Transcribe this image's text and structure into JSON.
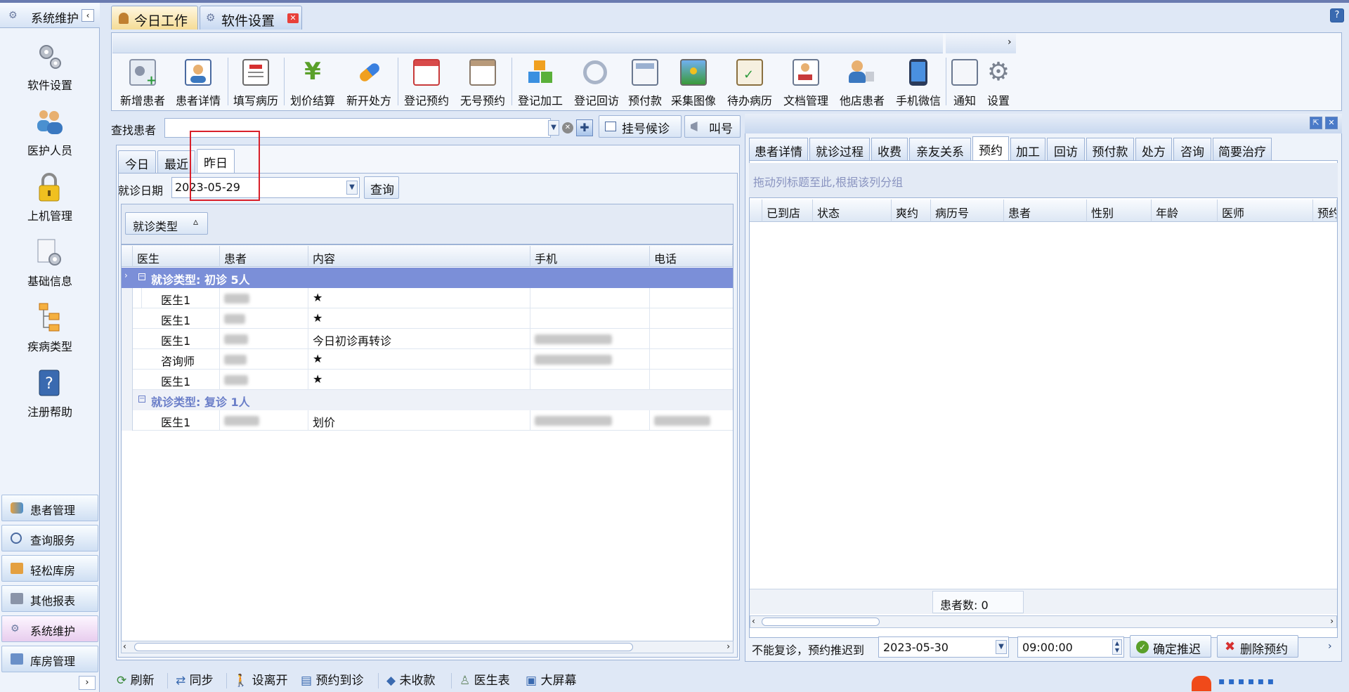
{
  "nav": {
    "header": "系统维护",
    "items": [
      {
        "label": "软件设置",
        "icon": "gears-icon"
      },
      {
        "label": "医护人员",
        "icon": "staff-icon"
      },
      {
        "label": "上机管理",
        "icon": "lock-icon"
      },
      {
        "label": "基础信息",
        "icon": "info-gear-icon"
      },
      {
        "label": "疾病类型",
        "icon": "tree-icon"
      },
      {
        "label": "注册帮助",
        "icon": "help-book-icon"
      }
    ],
    "sections": [
      "患者管理",
      "查询服务",
      "轻松库房",
      "其他报表",
      "系统维护",
      "库房管理"
    ]
  },
  "tabs": [
    {
      "label": "今日工作"
    },
    {
      "label": "软件设置"
    }
  ],
  "toolbar": {
    "buttons": [
      "新增患者",
      "患者详情",
      "填写病历",
      "划价结算",
      "新开处方",
      "登记预约",
      "无号预约",
      "登记加工",
      "登记回访",
      "预付款",
      "采集图像",
      "待办病历",
      "文档管理",
      "他店患者",
      "手机微信"
    ],
    "extra": [
      "通知",
      "设置"
    ],
    "more": "›"
  },
  "search": {
    "label": "查找患者",
    "value": "",
    "queue_button": "挂号候诊",
    "call_button": "叫号"
  },
  "left": {
    "tabs": [
      "今日",
      "最近",
      "昨日"
    ],
    "date_label": "就诊日期",
    "date_value": "2023-05-29",
    "query_button": "查询",
    "group_chip": "就诊类型",
    "group_chip_arrow": "▵",
    "columns": [
      "医生",
      "患者",
      "内容",
      "手机",
      "电话"
    ],
    "groups": [
      {
        "title": "就诊类型: 初诊 5人",
        "rows": [
          {
            "doctor": "医生1",
            "content": "★"
          },
          {
            "doctor": "医生1",
            "content": "★"
          },
          {
            "doctor": "医生1",
            "content": "今日初诊再转诊"
          },
          {
            "doctor": "咨询师",
            "content": "★"
          },
          {
            "doctor": "医生1",
            "content": "★"
          }
        ]
      },
      {
        "title": "就诊类型: 复诊 1人",
        "rows": [
          {
            "doctor": "医生1",
            "content": "划价"
          }
        ]
      }
    ]
  },
  "right": {
    "tabs": [
      "患者详情",
      "就诊过程",
      "收费",
      "亲友关系",
      "预约",
      "加工",
      "回访",
      "预付款",
      "处方",
      "咨询",
      "简要治疗"
    ],
    "active_tab": "预约",
    "group_hint": "拖动列标题至此,根据该列分组",
    "columns": [
      "已到店",
      "状态",
      "爽约",
      "病历号",
      "患者",
      "性别",
      "年龄",
      "医师",
      "预约"
    ],
    "count_label": "患者数: 0",
    "postpone_label": "不能复诊，预约推迟到",
    "postpone_date": "2023-05-30",
    "postpone_time": "09:00:00",
    "confirm_button": "确定推迟",
    "delete_button": "删除预约"
  },
  "bottom": [
    "刷新",
    "同步",
    "设离开",
    "预约到诊",
    "未收款",
    "医生表",
    "大屏幕"
  ],
  "colors": {
    "accent": "#7b8fd8",
    "border": "#9db3d6",
    "highlight_box": "#d9202a"
  }
}
